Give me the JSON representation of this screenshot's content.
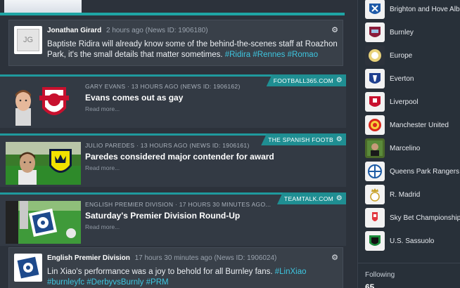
{
  "feed": {
    "social_top": {
      "author": "Jonathan Girard",
      "meta": "2 hours ago (News ID: 1906180)",
      "avatar_initials": "JG",
      "text": "Baptiste Ridira will already know some of the behind-the-scenes staff at Roazhon Park, it's the small details that matter sometimes.",
      "tags": [
        "#Ridira",
        "#Rennes",
        "#Romao"
      ]
    },
    "news": [
      {
        "meta": "GARY EVANS  ·  13 HOURS AGO (NEWS ID: 1906162)",
        "headline": "Evans comes out as gay",
        "read_more": "Read more...",
        "source": "FOOTBALL365.COM"
      },
      {
        "meta": "JULIO PAREDES  ·  13 HOURS AGO (NEWS ID: 1906161)",
        "headline": "Paredes considered major contender for award",
        "read_more": "Read more...",
        "source": "THE SPANISH FOOTB"
      },
      {
        "meta": "ENGLISH PREMIER DIVISION  ·  17 HOURS 30 MINUTES AGO...",
        "headline": "Saturday's Premier Division Round-Up",
        "read_more": "Read more...",
        "source": "TEAMTALK.COM"
      }
    ],
    "social_bottom": {
      "author": "English Premier Division",
      "meta": "17 hours 30 minutes ago (News ID: 1906024)",
      "text": "Lin Xiao's performance was a joy to behold for all Burnley fans.",
      "tags": [
        "#LinXiao",
        "#burnleyfc",
        "#DerbyvsBurnly",
        "#PRM"
      ]
    }
  },
  "clubs": [
    {
      "name": "Brighton and Hove Albi",
      "icon": "brighton-crest-icon",
      "color": "#1e5aa8"
    },
    {
      "name": "Burnley",
      "icon": "burnley-crest-icon",
      "color": "#8a1c3a"
    },
    {
      "name": "Europe",
      "icon": "europe-icon",
      "color": "#c9a227"
    },
    {
      "name": "Everton",
      "icon": "everton-crest-icon",
      "color": "#1f3f8f"
    },
    {
      "name": "Liverpool",
      "icon": "liverpool-crest-icon",
      "color": "#c8102e"
    },
    {
      "name": "Manchester United",
      "icon": "manutd-crest-icon",
      "color": "#da291c"
    },
    {
      "name": "Marcelino",
      "icon": "person-photo-icon",
      "color": "#4a6a2a"
    },
    {
      "name": "Queens Park Rangers",
      "icon": "qpr-crest-icon",
      "color": "#1d5ba4"
    },
    {
      "name": "R. Madrid",
      "icon": "realmadrid-crest-icon",
      "color": "#c9a227"
    },
    {
      "name": "Sky Bet Championship",
      "icon": "championship-icon",
      "color": "#e2373f"
    },
    {
      "name": "U.S. Sassuolo",
      "icon": "sassuolo-crest-icon",
      "color": "#1a8a3a"
    }
  ],
  "following_label": "Following",
  "following_value": "65"
}
